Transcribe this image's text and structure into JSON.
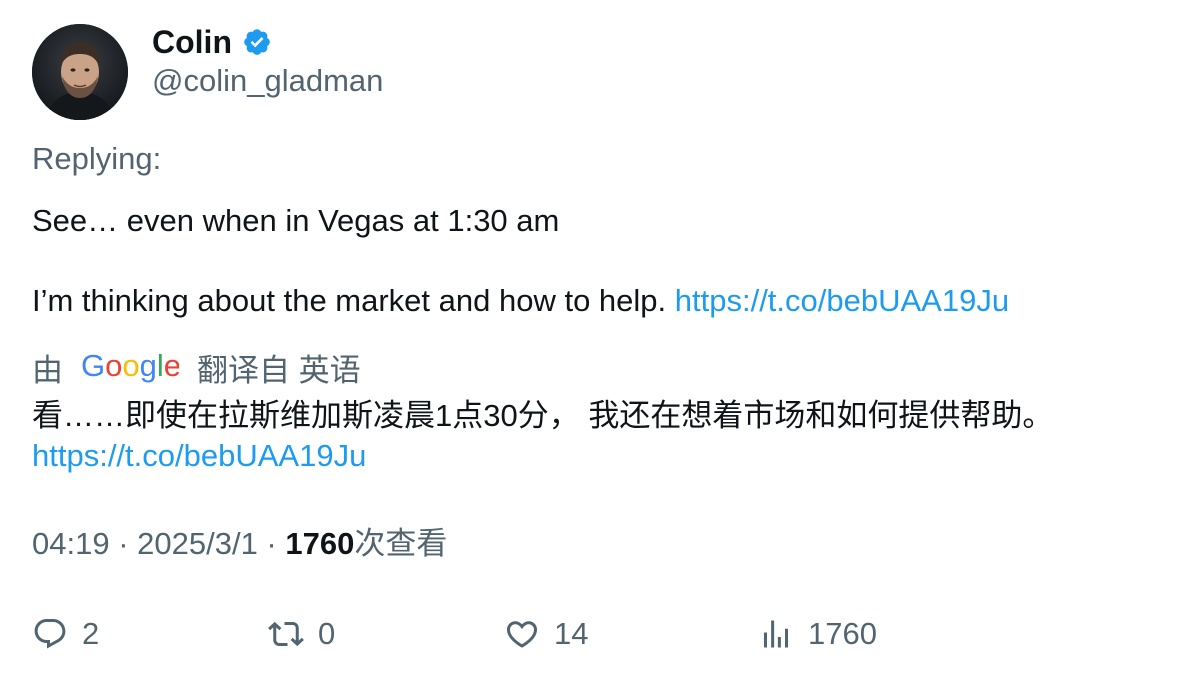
{
  "author": {
    "display_name": "Colin",
    "handle": "@colin_gladman",
    "verified": true,
    "verified_color": "#1d9bf0"
  },
  "replying_label": "Replying:",
  "tweet": {
    "line1": "See… even when in Vegas at 1:30 am",
    "line2_text": "I’m thinking about the market and how to help. ",
    "link": "https://t.co/bebUAA19Ju"
  },
  "translation": {
    "by_label": "由",
    "provider": "Google",
    "from_label": "翻译自 英语",
    "text": "看……即使在拉斯维加斯凌晨1点30分， 我还在想着市场和如何提供帮助。",
    "link": "https://t.co/bebUAA19Ju"
  },
  "meta": {
    "time": "04:19",
    "separator": " · ",
    "date": "2025/3/1",
    "views_count": "1760",
    "views_label": "次查看"
  },
  "actions": {
    "reply_count": "2",
    "retweet_count": "0",
    "like_count": "14",
    "views_count": "1760"
  },
  "colors": {
    "link": "#1d9bf0",
    "secondary_text": "#536471",
    "primary_text": "#0f1419"
  }
}
